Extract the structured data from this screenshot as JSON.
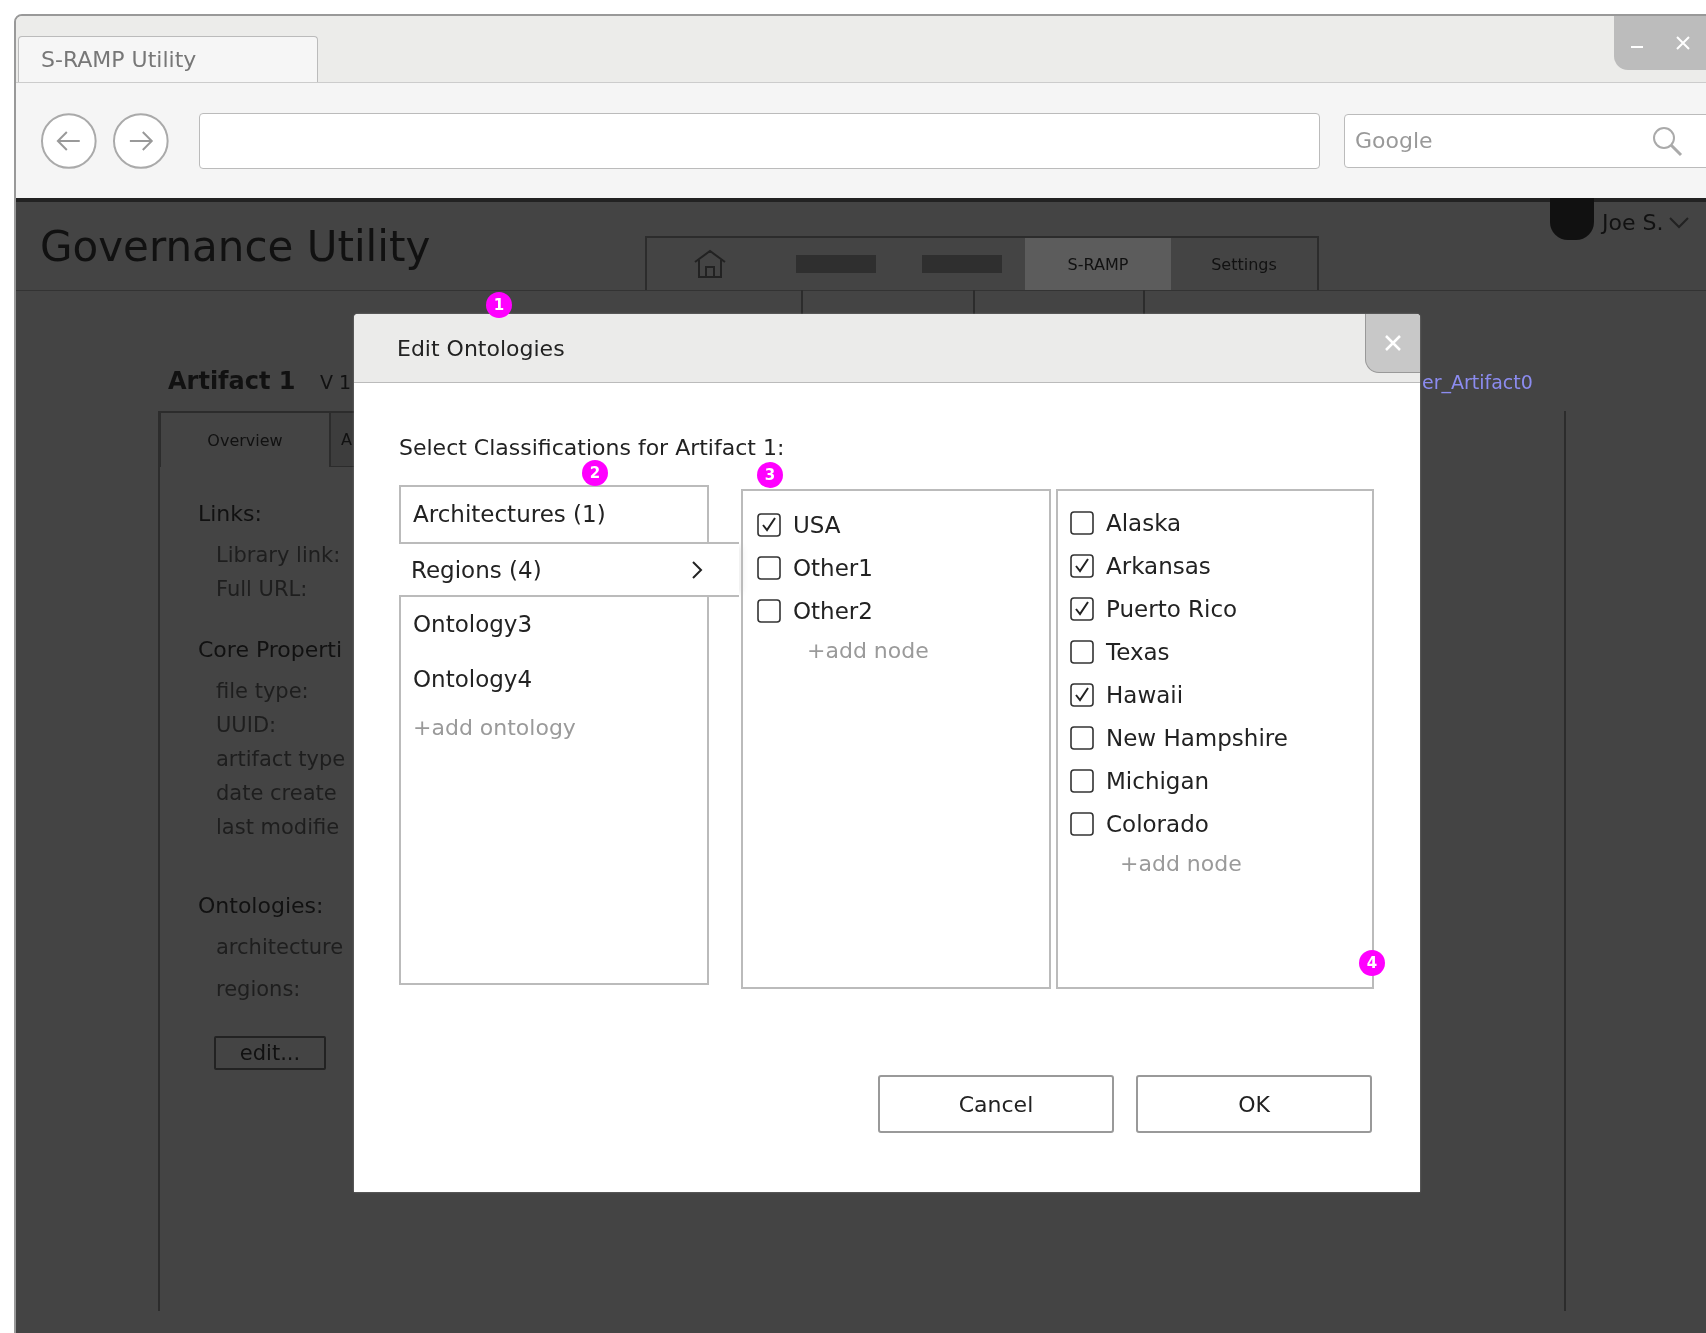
{
  "browser": {
    "tab_title": "S-RAMP Utility",
    "search_placeholder": "Google"
  },
  "app": {
    "title": "Governance Utility",
    "user": "Joe S.",
    "nav": [
      {
        "kind": "home",
        "selected": false
      },
      {
        "kind": "blank",
        "selected": false
      },
      {
        "kind": "blank",
        "selected": false
      },
      {
        "kind": "text",
        "label": "S-RAMP",
        "selected": true
      },
      {
        "kind": "text",
        "label": "Settings",
        "selected": false
      }
    ]
  },
  "artifact": {
    "name": "Artifact 1",
    "version": "V 1",
    "link_tail": "er_Artifact0",
    "tabs": [
      {
        "label": "Overview",
        "selected": true
      },
      {
        "label": "A",
        "selected": false
      }
    ],
    "sections": [
      {
        "heading": "Links:",
        "fields": [
          "Library link:",
          "Full URL:"
        ]
      },
      {
        "heading": "Core Properti",
        "fields": [
          "file type:",
          "UUID:",
          "artifact type",
          "date create",
          "last modifie"
        ]
      },
      {
        "heading": "Ontologies:",
        "fields": [
          "architecture",
          "regions:"
        ]
      }
    ],
    "edit_button": "edit..."
  },
  "dialog": {
    "title": "Edit Ontologies",
    "prompt": "Select Classifications for Artifact 1:",
    "ontologies": [
      {
        "label": "Architectures (1)",
        "selected": false
      },
      {
        "label": "Regions (4)",
        "selected": true
      },
      {
        "label": "Ontology3",
        "selected": false
      },
      {
        "label": "Ontology4",
        "selected": false
      }
    ],
    "add_ontology": "+add ontology",
    "nodes": [
      {
        "label": "USA",
        "checked": true
      },
      {
        "label": "Other1",
        "checked": false
      },
      {
        "label": "Other2",
        "checked": false
      }
    ],
    "add_node": "+add node",
    "subnodes": [
      {
        "label": "Alaska",
        "checked": false
      },
      {
        "label": "Arkansas",
        "checked": true
      },
      {
        "label": "Puerto Rico",
        "checked": true
      },
      {
        "label": "Texas",
        "checked": false
      },
      {
        "label": "Hawaii",
        "checked": true
      },
      {
        "label": "New Hampshire",
        "checked": false
      },
      {
        "label": "Michigan",
        "checked": false
      },
      {
        "label": "Colorado",
        "checked": false
      }
    ],
    "add_subnode": "+add node",
    "buttons": [
      "Cancel",
      "OK"
    ]
  },
  "annotations": [
    "1",
    "2",
    "3",
    "4"
  ]
}
